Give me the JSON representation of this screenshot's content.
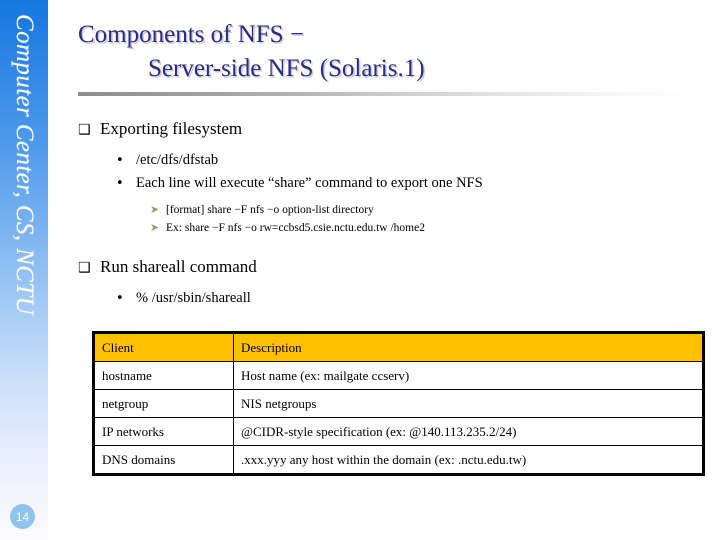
{
  "sidebar": {
    "vertical_text": "Computer Center, CS, NCTU",
    "page_number": "14",
    "gradient_top_color": "#1477e0",
    "gradient_bottom_color": "#fbfbff",
    "page_bubble_color": "#8ec5f0"
  },
  "title": {
    "line1": "Components of NFS −",
    "line2": "Server-side NFS (Solaris.1)",
    "color": "#2b2b80"
  },
  "content": {
    "section1": {
      "bullet_glyph": "❑",
      "heading": "Exporting filesystem",
      "items": [
        {
          "glyph": "•",
          "text": "/etc/dfs/dfstab"
        },
        {
          "glyph": "•",
          "text": "Each line will execute “share” command to export one NFS"
        }
      ],
      "subitems": [
        {
          "glyph": "➤",
          "text": "[format] share −F nfs −o option-list directory"
        },
        {
          "glyph": "➤",
          "text": "Ex: share −F nfs −o rw=ccbsd5.csie.nctu.edu.tw /home2"
        }
      ]
    },
    "section2": {
      "bullet_glyph": "❑",
      "heading": "Run shareall command",
      "items": [
        {
          "glyph": "•",
          "text": "% /usr/sbin/shareall"
        }
      ]
    }
  },
  "table": {
    "header_color": "#ffc000",
    "columns": [
      "Client",
      "Description"
    ],
    "rows": [
      [
        "hostname",
        "Host name (ex: mailgate ccserv)"
      ],
      [
        "netgroup",
        "NIS netgroups"
      ],
      [
        "IP networks",
        "@CIDR-style specification (ex: @140.113.235.2/24)"
      ],
      [
        "DNS domains",
        ".xxx.yyy any host within the domain (ex: .nctu.edu.tw)"
      ]
    ]
  }
}
